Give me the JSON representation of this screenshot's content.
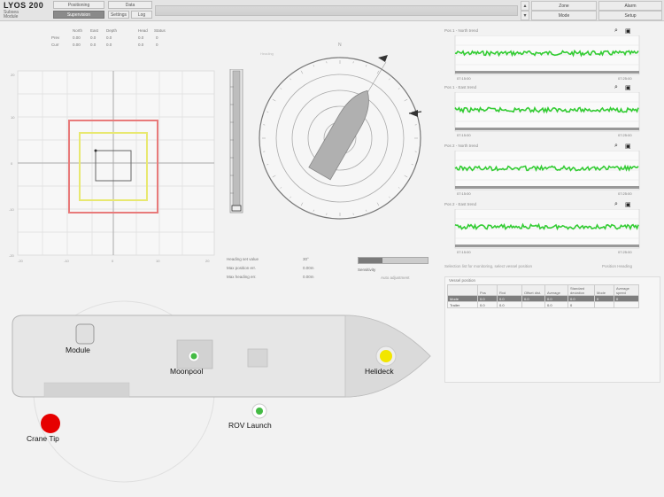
{
  "app": {
    "title": "LYOS 200",
    "subtitle_line1": "Subsea",
    "subtitle_line2": "Module"
  },
  "tabs": [
    {
      "label": "Positioning",
      "active": false
    },
    {
      "label": "Supervision",
      "active": true
    },
    {
      "label": "Data",
      "active": false
    },
    {
      "label": "Settings",
      "active": false
    },
    {
      "label": "Log",
      "active": false
    }
  ],
  "top_buttons": [
    {
      "label": "Zone"
    },
    {
      "label": "Alarm"
    },
    {
      "label": "Mode"
    },
    {
      "label": "Setup"
    }
  ],
  "readout": {
    "header": [
      "",
      "North",
      "East",
      "Depth",
      "Head",
      "Status"
    ],
    "rows": [
      {
        "label": "Prev",
        "values": [
          "0.00",
          "0.0",
          "0.0",
          "0.0",
          "0"
        ]
      },
      {
        "label": "Curr",
        "values": [
          "0.00",
          "0.0",
          "0.0",
          "0.0",
          "0"
        ]
      }
    ]
  },
  "plot": {
    "tick_labels_left": [
      "20",
      "10",
      "0",
      "-10",
      "-20"
    ],
    "tick_labels_bottom": [
      "-20",
      "-10",
      "0",
      "10",
      "20"
    ]
  },
  "compass": {
    "north_label": "N",
    "title": "Heading"
  },
  "info": {
    "lines": [
      {
        "label": "Heading set value",
        "value": "30°"
      },
      {
        "label": "Max position err.",
        "value": "0.00m"
      },
      {
        "label": "Max heading err.",
        "value": "0.00m"
      }
    ]
  },
  "slider": {
    "label": "Sensitivity",
    "sublabel": "Auto adjustment",
    "level": 0.35
  },
  "trends": [
    {
      "title": "Pos 1 - North trend",
      "x_left": "07:15:00",
      "x_right": "07:25:00"
    },
    {
      "title": "Pos 1 - East trend",
      "x_left": "07:15:00",
      "x_right": "07:25:00"
    },
    {
      "title": "Pos 2 - North trend",
      "x_left": "07:15:00",
      "x_right": "07:25:00"
    },
    {
      "title": "Pos 2 - East trend",
      "x_left": "07:15:00",
      "x_right": "07:25:00"
    }
  ],
  "list": {
    "caption": "Selection list for monitoring, select vessel position",
    "caption_right": "Position  Heading",
    "box_title": "Vessel position",
    "headers": [
      "",
      "Pos",
      "Rxd",
      "Offset dist.",
      "Average",
      "Standard deviation",
      "Mode",
      "Average speed"
    ],
    "rows": [
      {
        "cells": [
          "Mode",
          "0.0",
          "0.0",
          "0.0",
          "0.0",
          "0.0",
          "0",
          "0"
        ],
        "selected": true
      },
      {
        "cells": [
          "Trailer",
          "0.0",
          "0.0",
          "",
          "0.0",
          "0",
          "",
          ""
        ],
        "selected": false
      }
    ]
  },
  "vessel": {
    "labels": {
      "module": "Module",
      "moonpool": "Moonpool",
      "helideck": "Helideck",
      "rov": "ROV Launch",
      "crane": "Crane Tip"
    }
  },
  "colors": {
    "red_zone": "#e87a7a",
    "yellow_zone": "#e8e870",
    "trend_green": "#33cc33",
    "helideck_dot": "#f2e600",
    "crane_dot": "#e60000",
    "status_green": "#44bb44"
  }
}
